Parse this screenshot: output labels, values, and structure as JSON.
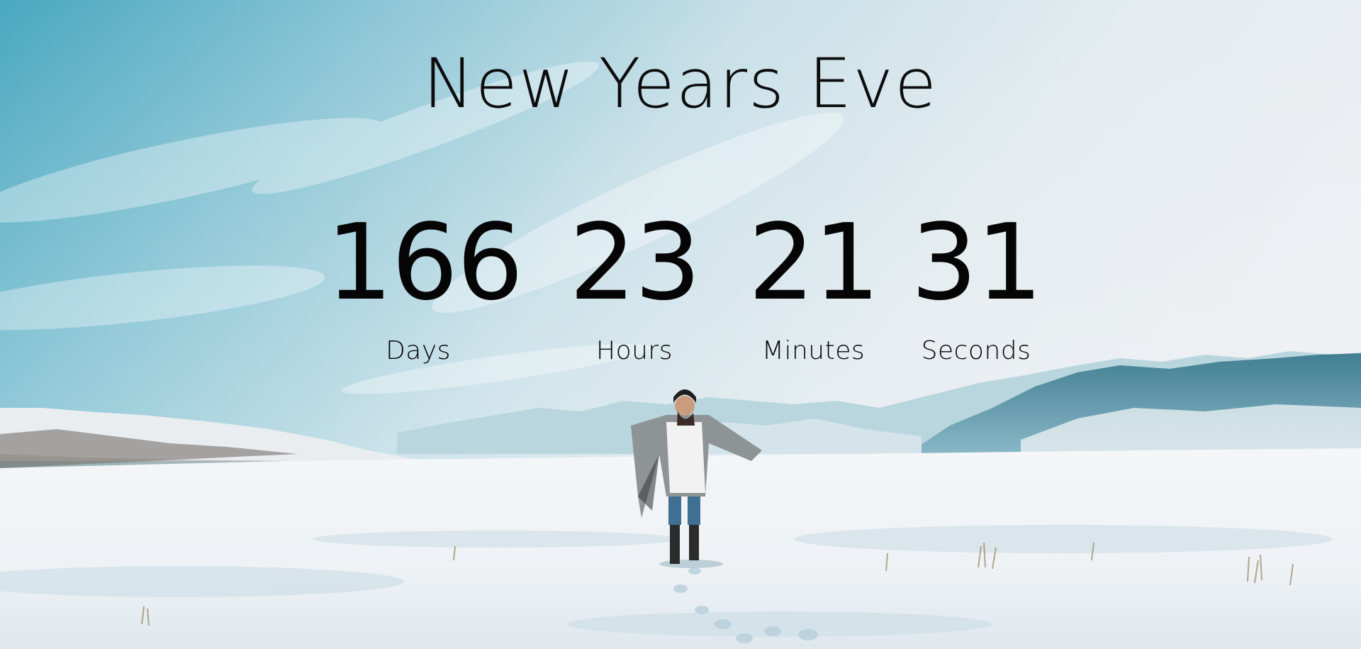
{
  "event": {
    "title": "New Years Eve"
  },
  "countdown": {
    "days": {
      "value": "166",
      "label": "Days"
    },
    "hours": {
      "value": "23",
      "label": "Hours"
    },
    "minutes": {
      "value": "21",
      "label": "Minutes"
    },
    "seconds": {
      "value": "31",
      "label": "Seconds"
    }
  },
  "colors": {
    "text": "#0c0c0c",
    "sky_blue": "#5fb3c8",
    "snow": "#eef3f6"
  }
}
